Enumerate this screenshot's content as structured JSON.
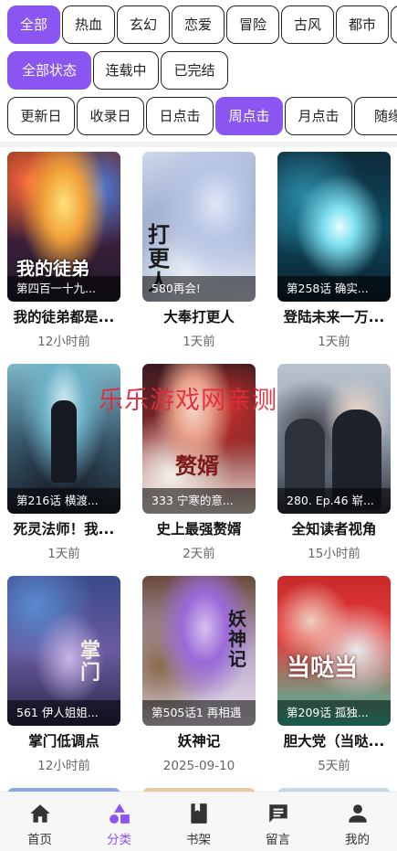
{
  "filters": {
    "genres": [
      "全部",
      "热血",
      "玄幻",
      "恋爱",
      "冒险",
      "古风",
      "都市"
    ],
    "genre_selected": "全部",
    "statuses": [
      "全部状态",
      "连载中",
      "已完结"
    ],
    "status_selected": "全部状态",
    "sorts": [
      "更新日",
      "收录日",
      "日点击",
      "周点击",
      "月点击",
      "随缘"
    ],
    "sort_selected": "周点击"
  },
  "comics": [
    {
      "title": "我的徒弟都是...",
      "episode": "第四百一十九...",
      "time": "12小时前",
      "cover_logo": "我的徒弟"
    },
    {
      "title": "大奉打更人",
      "episode": "580再会!",
      "time": "1天前",
      "cover_logo": "打更人"
    },
    {
      "title": "登陆未来一万...",
      "episode": "第258话 确实...",
      "time": "1天前",
      "cover_logo": ""
    },
    {
      "title": "死灵法师！我...",
      "episode": "第216话 横渡...",
      "time": "1天前",
      "cover_logo": ""
    },
    {
      "title": "史上最强赘婿",
      "episode": "333 宁寒的意...",
      "time": "2天前",
      "cover_logo": "赘婿"
    },
    {
      "title": "全知读者视角",
      "episode": "280. Ep.46 崭...",
      "time": "15小时前",
      "cover_logo": ""
    },
    {
      "title": "掌门低调点",
      "episode": "561 伊人姐姐...",
      "time": "12小时前",
      "cover_logo": "掌门"
    },
    {
      "title": "妖神记",
      "episode": "第505话1 再相遇",
      "time": "2025-09-10",
      "cover_logo": "妖神记"
    },
    {
      "title": "胆大党（当哒...",
      "episode": "第209话 孤独...",
      "time": "5天前",
      "cover_logo": "当哒当"
    }
  ],
  "watermark": "乐乐游戏网亲测",
  "tabs": [
    {
      "label": "首页",
      "icon": "home-icon"
    },
    {
      "label": "分类",
      "icon": "category-icon"
    },
    {
      "label": "书架",
      "icon": "bookshelf-icon"
    },
    {
      "label": "留言",
      "icon": "message-icon"
    },
    {
      "label": "我的",
      "icon": "profile-icon"
    }
  ],
  "tab_selected": "分类",
  "colors": {
    "accent": "#8a55f0",
    "watermark": "#e62a3a"
  }
}
